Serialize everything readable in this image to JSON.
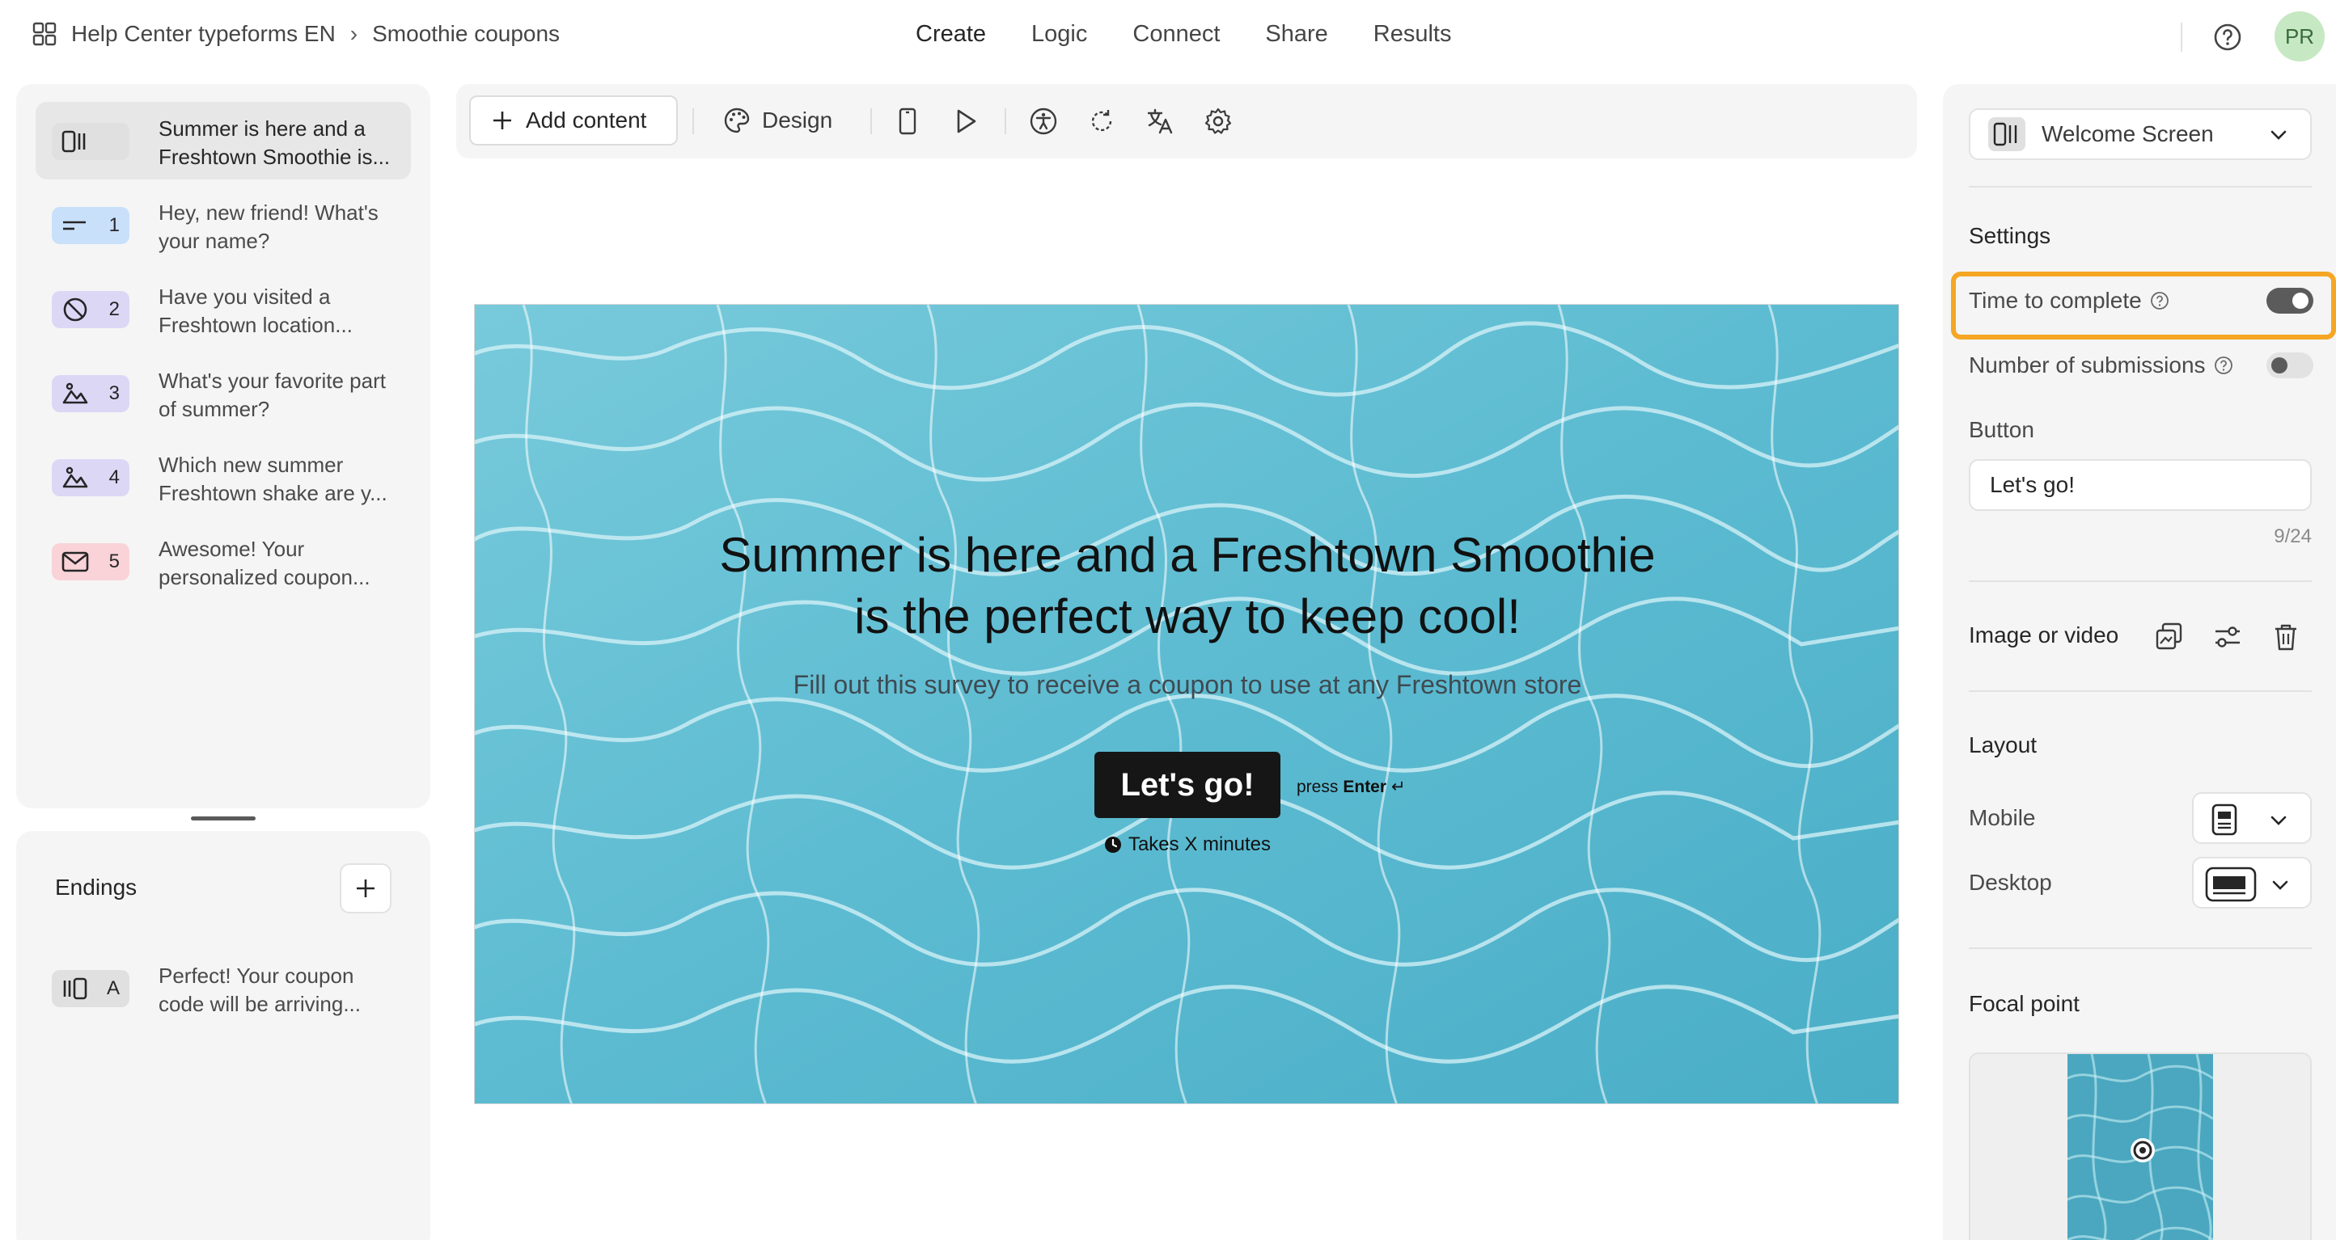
{
  "breadcrumb": {
    "workspace": "Help Center typeforms EN",
    "separator": "›",
    "form": "Smoothie coupons"
  },
  "nav": {
    "create": "Create",
    "logic": "Logic",
    "connect": "Connect",
    "share": "Share",
    "results": "Results"
  },
  "user": {
    "initials": "PR"
  },
  "questions": [
    {
      "number": "",
      "text": "Summer is here and a Freshtown Smoothie is...",
      "icon": "welcome-screen-icon",
      "color": "#e0e0e0"
    },
    {
      "number": "1",
      "text": "Hey, new friend! What's your name?",
      "icon": "short-text-icon",
      "color": "#c9e0fa"
    },
    {
      "number": "2",
      "text": "Have you visited a Freshtown location...",
      "icon": "yes-no-icon",
      "color": "#ddd7f6"
    },
    {
      "number": "3",
      "text": "What's your favorite part of summer?",
      "icon": "picture-choice-icon",
      "color": "#ddd7f6"
    },
    {
      "number": "4",
      "text": "Which new summer Freshtown shake are y...",
      "icon": "picture-choice-icon",
      "color": "#ddd7f6"
    },
    {
      "number": "5",
      "text": "Awesome! Your personalized coupon...",
      "icon": "email-icon",
      "color": "#f9d3d8"
    }
  ],
  "endings": {
    "title": "Endings",
    "items": [
      {
        "letter": "A",
        "text": "Perfect! Your coupon code will be arriving..."
      }
    ]
  },
  "toolbar": {
    "add_content": "Add content",
    "design": "Design"
  },
  "preview": {
    "title": "Summer is here and a Freshtown Smoothie is the perfect way to keep cool!",
    "subtitle": "Fill out this survey to receive a coupon to use at any Freshtown store",
    "button": "Let's go!",
    "press": "press",
    "enter": "Enter",
    "enter_symbol": "↵",
    "time": "Takes X minutes"
  },
  "settings_panel": {
    "screen_type": "Welcome Screen",
    "settings_title": "Settings",
    "time_to_complete": "Time to complete",
    "time_to_complete_on": true,
    "number_of_submissions": "Number of submissions",
    "number_of_submissions_on": false,
    "button_label": "Button",
    "button_value": "Let's go!",
    "button_counter": "9/24",
    "image_or_video": "Image or video",
    "layout_title": "Layout",
    "mobile": "Mobile",
    "desktop": "Desktop",
    "focal_point": "Focal point"
  },
  "colors": {
    "highlight": "#f5a623",
    "toggle_on": "#5b5b5b",
    "panel_bg": "#f5f5f5",
    "water": "#5fbdd2"
  }
}
